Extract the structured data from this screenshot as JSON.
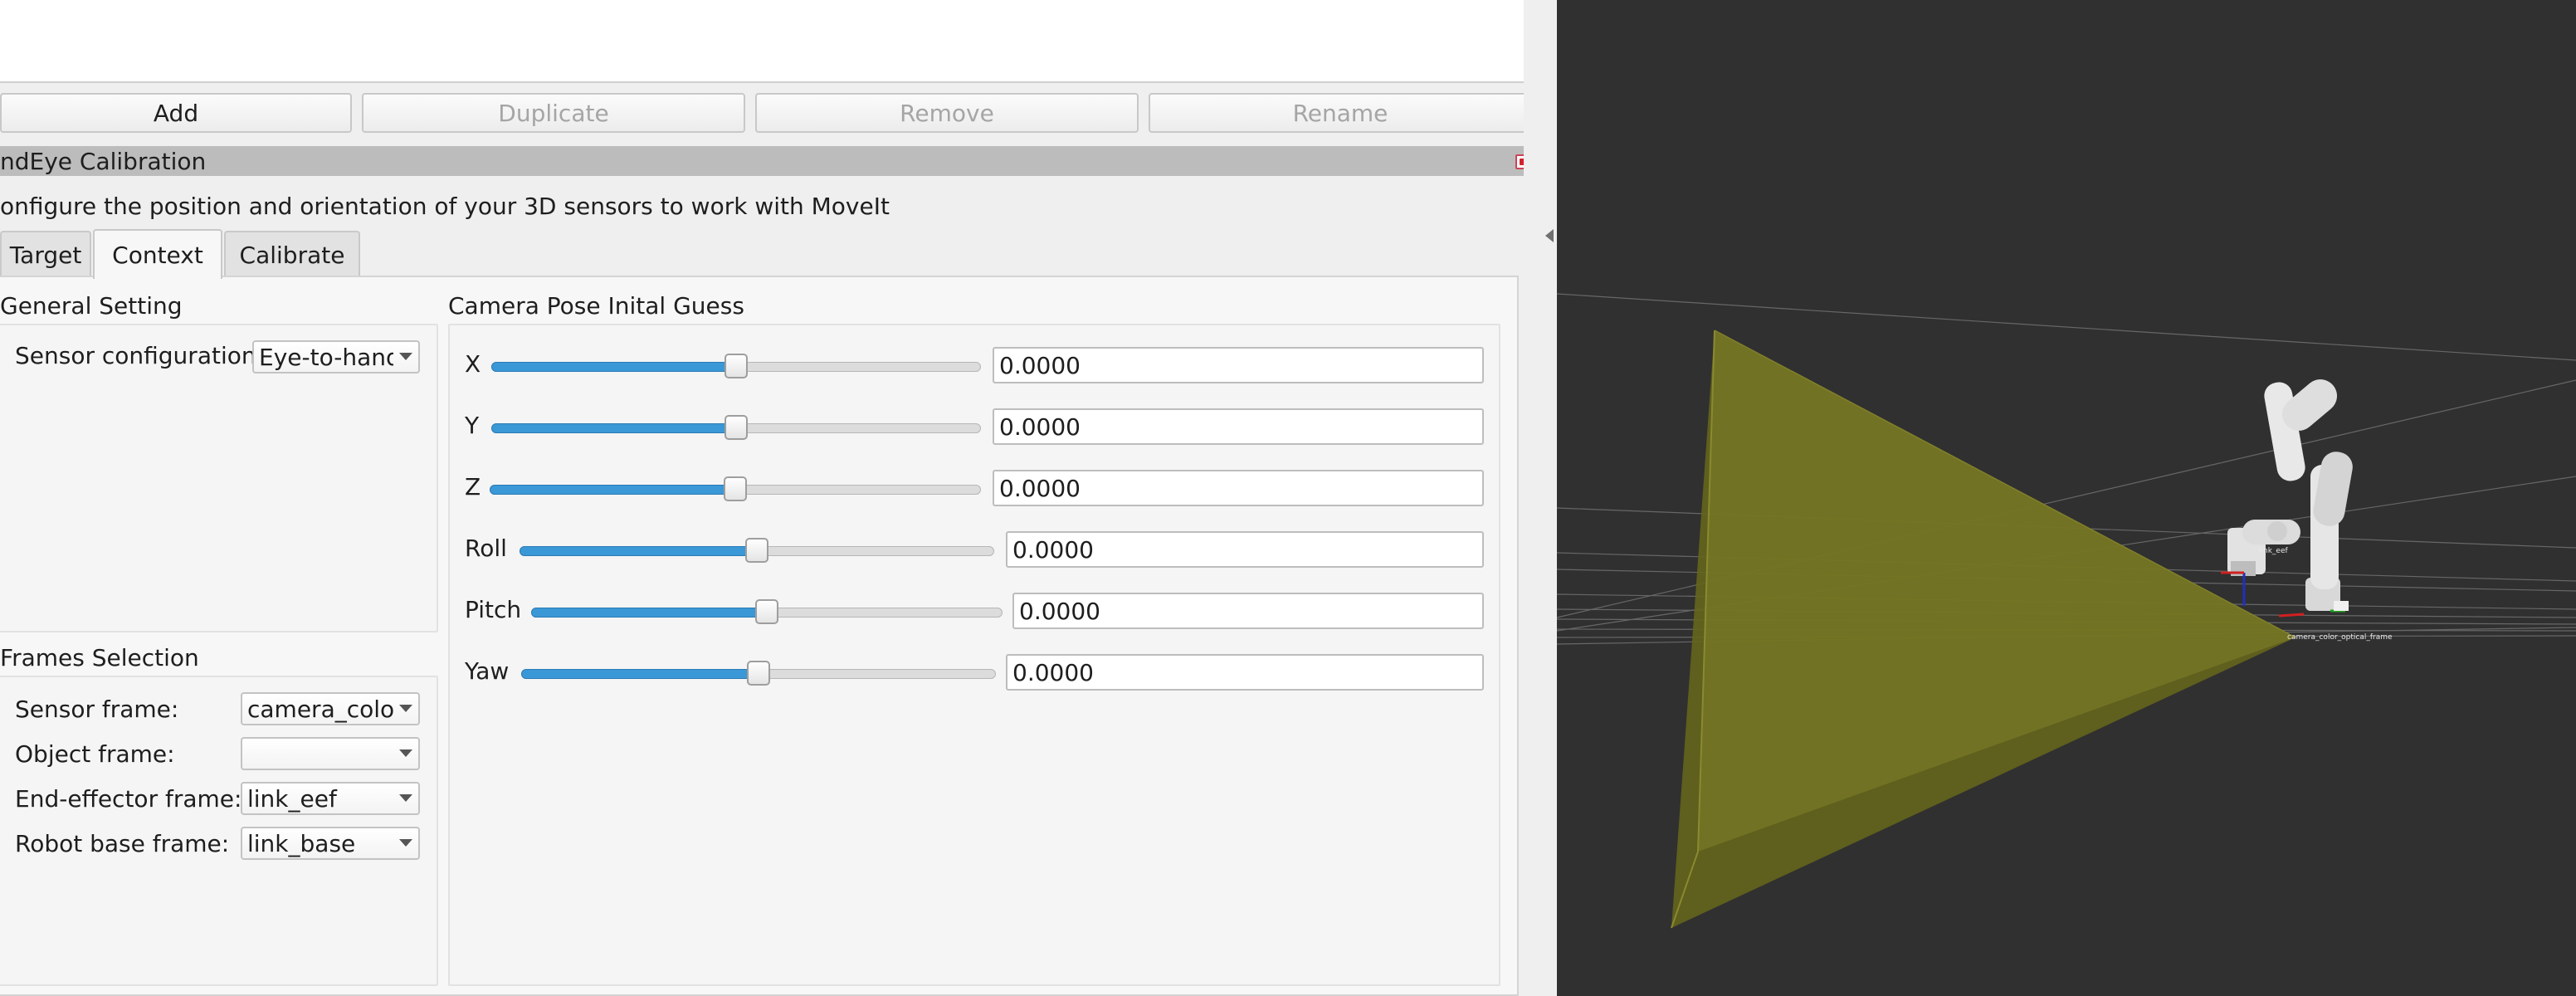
{
  "toolbar": {
    "add_label": "Add",
    "duplicate_label": "Duplicate",
    "remove_label": "Remove",
    "rename_label": "Rename"
  },
  "panel": {
    "title": "ndEye Calibration",
    "description": "onfigure the position and orientation of your 3D sensors to work with MoveIt"
  },
  "tabs": [
    {
      "label": "Target",
      "active": false
    },
    {
      "label": "Context",
      "active": true
    },
    {
      "label": "Calibrate",
      "active": false
    }
  ],
  "general_setting": {
    "title": "General Setting",
    "sensor_configuration_label": "Sensor configuration",
    "sensor_configuration_value": "Eye-to-hand"
  },
  "frames_selection": {
    "title": "Frames Selection",
    "sensor_frame_label": "Sensor frame:",
    "sensor_frame_value": "camera_color",
    "object_frame_label": "Object frame:",
    "object_frame_value": "",
    "end_effector_frame_label": "End-effector frame:",
    "end_effector_frame_value": "link_eef",
    "robot_base_frame_label": "Robot base frame:",
    "robot_base_frame_value": "link_base"
  },
  "camera_pose": {
    "title": "Camera Pose Inital Guess",
    "rows": [
      {
        "label": "X",
        "value": "0.0000",
        "slider_fraction": 0.5
      },
      {
        "label": "Y",
        "value": "0.0000",
        "slider_fraction": 0.5
      },
      {
        "label": "Z",
        "value": "0.0000",
        "slider_fraction": 0.5
      },
      {
        "label": "Roll",
        "value": "0.0000",
        "slider_fraction": 0.5
      },
      {
        "label": "Pitch",
        "value": "0.0000",
        "slider_fraction": 0.5
      },
      {
        "label": "Yaw",
        "value": "0.0000",
        "slider_fraction": 0.5
      }
    ]
  },
  "viewport": {
    "frame_label_1": "link_eef",
    "frame_label_2": "camera_color_optical_frame",
    "background_color": "#303030",
    "frustum_color": "#6b6b1f"
  },
  "colors": {
    "accent": "#3b98d6",
    "panel_title_bg": "#bcbcbc"
  }
}
